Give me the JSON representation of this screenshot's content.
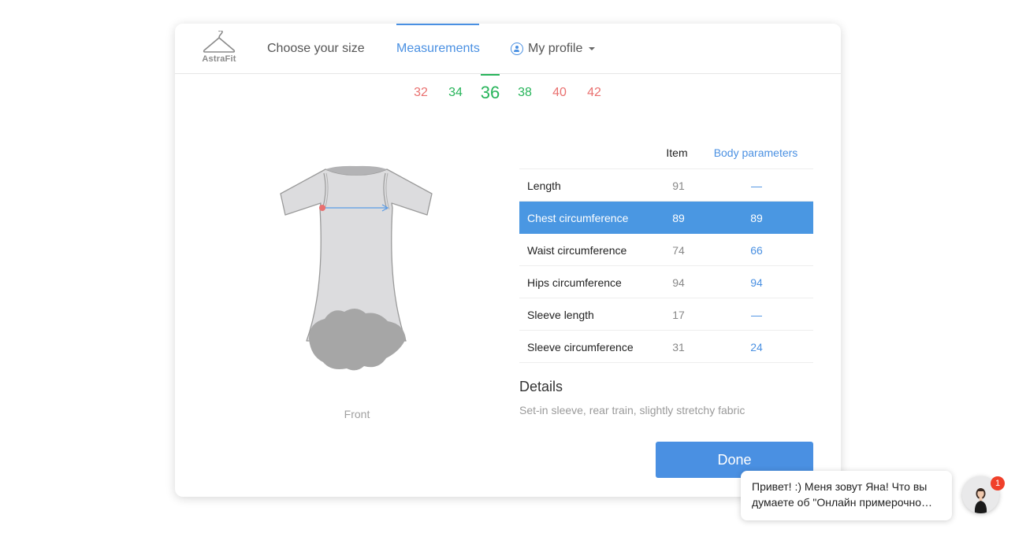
{
  "brand": {
    "name": "AstraFit"
  },
  "nav": {
    "choose_size": "Choose your size",
    "measurements": "Measurements",
    "my_profile": "My profile"
  },
  "sizes": [
    {
      "label": "32",
      "status": "red"
    },
    {
      "label": "34",
      "status": "green"
    },
    {
      "label": "36",
      "status": "green",
      "selected": true
    },
    {
      "label": "38",
      "status": "green"
    },
    {
      "label": "40",
      "status": "red"
    },
    {
      "label": "42",
      "status": "red"
    }
  ],
  "garment": {
    "view_label": "Front"
  },
  "table": {
    "col_item": "Item",
    "col_body": "Body parameters",
    "rows": [
      {
        "name": "Length",
        "item": "91",
        "body": "—"
      },
      {
        "name": "Chest circumference",
        "item": "89",
        "body": "89",
        "active": true
      },
      {
        "name": "Waist circumference",
        "item": "74",
        "body": "66"
      },
      {
        "name": "Hips circumference",
        "item": "94",
        "body": "94"
      },
      {
        "name": "Sleeve length",
        "item": "17",
        "body": "—"
      },
      {
        "name": "Sleeve circumference",
        "item": "31",
        "body": "24"
      }
    ]
  },
  "details": {
    "title": "Details",
    "text": "Set-in sleeve, rear train, slightly stretchy fabric"
  },
  "actions": {
    "done": "Done"
  },
  "chat": {
    "line1": "Привет! :) Меня зовут Яна! Что вы",
    "line2": "думаете об \"Онлайн примерочно…",
    "badge": "1"
  },
  "colors": {
    "accent": "#4a90e2",
    "available": "#27b45a",
    "unavailable": "#e9706f",
    "active_row": "#4a97e2",
    "badge": "#f0402a"
  },
  "icons": [
    "hanger-icon",
    "profile-icon",
    "chevron-down-icon",
    "chest-measure-arrow-icon"
  ]
}
